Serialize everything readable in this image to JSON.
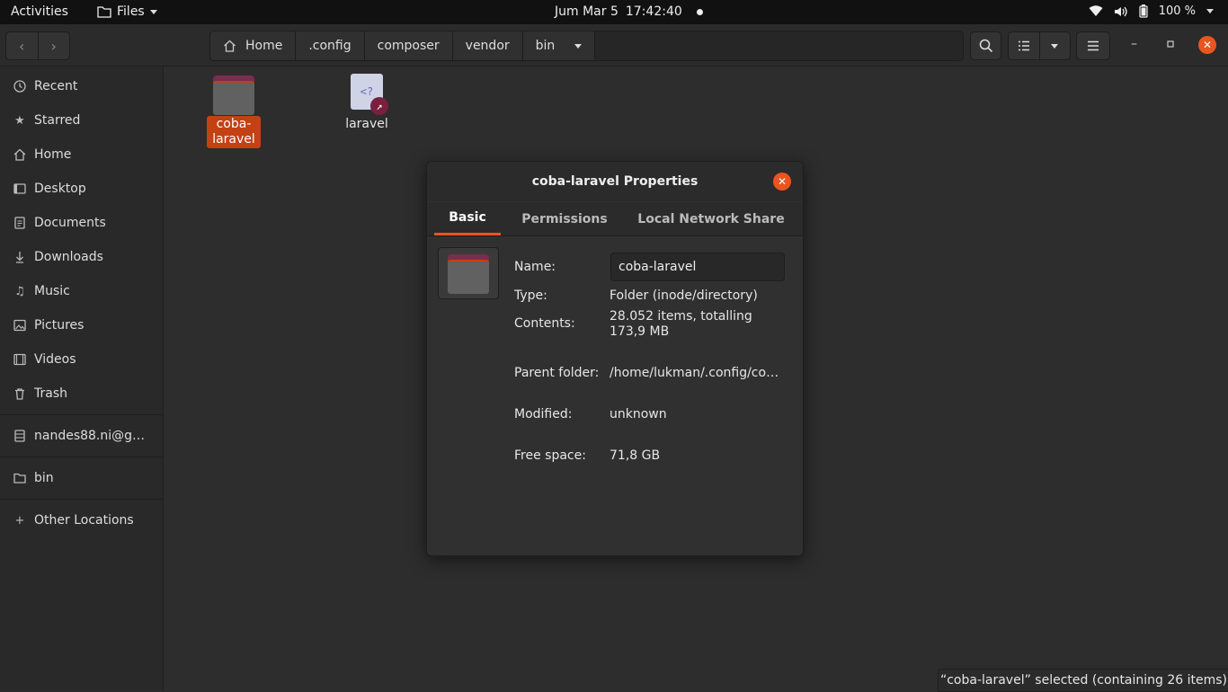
{
  "topbar": {
    "activities": "Activities",
    "app_name": "Files",
    "date": "Jum Mar 5",
    "time": "17:42:40",
    "battery": "100 %"
  },
  "header": {
    "breadcrumbs": [
      "Home",
      ".config",
      "composer",
      "vendor",
      "bin"
    ]
  },
  "sidebar": {
    "items": [
      {
        "label": "Recent",
        "icon": "clock-icon"
      },
      {
        "label": "Starred",
        "icon": "star-icon"
      },
      {
        "label": "Home",
        "icon": "home-icon"
      },
      {
        "label": "Desktop",
        "icon": "desktop-icon"
      },
      {
        "label": "Documents",
        "icon": "document-icon"
      },
      {
        "label": "Downloads",
        "icon": "download-icon"
      },
      {
        "label": "Music",
        "icon": "music-icon"
      },
      {
        "label": "Pictures",
        "icon": "picture-icon"
      },
      {
        "label": "Videos",
        "icon": "video-icon"
      },
      {
        "label": "Trash",
        "icon": "trash-icon"
      }
    ],
    "network": "nandes88.ni@g…",
    "bookmark": "bin",
    "other": "Other Locations"
  },
  "files": [
    {
      "name": "coba-\nlaravel",
      "name_line1": "coba-",
      "name_line2": "laravel",
      "type": "folder",
      "selected": true
    },
    {
      "name": "laravel",
      "type": "php-link",
      "icon_text": "<?"
    }
  ],
  "dialog": {
    "title": "coba-laravel Properties",
    "tabs": [
      "Basic",
      "Permissions",
      "Local Network Share"
    ],
    "active_tab": "Basic",
    "labels": {
      "name": "Name:",
      "type": "Type:",
      "contents": "Contents:",
      "parent": "Parent folder:",
      "modified": "Modified:",
      "free": "Free space:"
    },
    "values": {
      "name": "coba-laravel",
      "type": "Folder (inode/directory)",
      "contents_line1": "28.052 items, totalling",
      "contents_line2": "173,9 MB",
      "parent": "/home/lukman/.config/co…",
      "modified": "unknown",
      "free": "71,8 GB"
    }
  },
  "statusbar": {
    "text": "“coba-laravel” selected  (containing 26 items)"
  },
  "colors": {
    "accent": "#e95420",
    "selection": "#c34113",
    "folder_back": "#7a2d4f"
  }
}
